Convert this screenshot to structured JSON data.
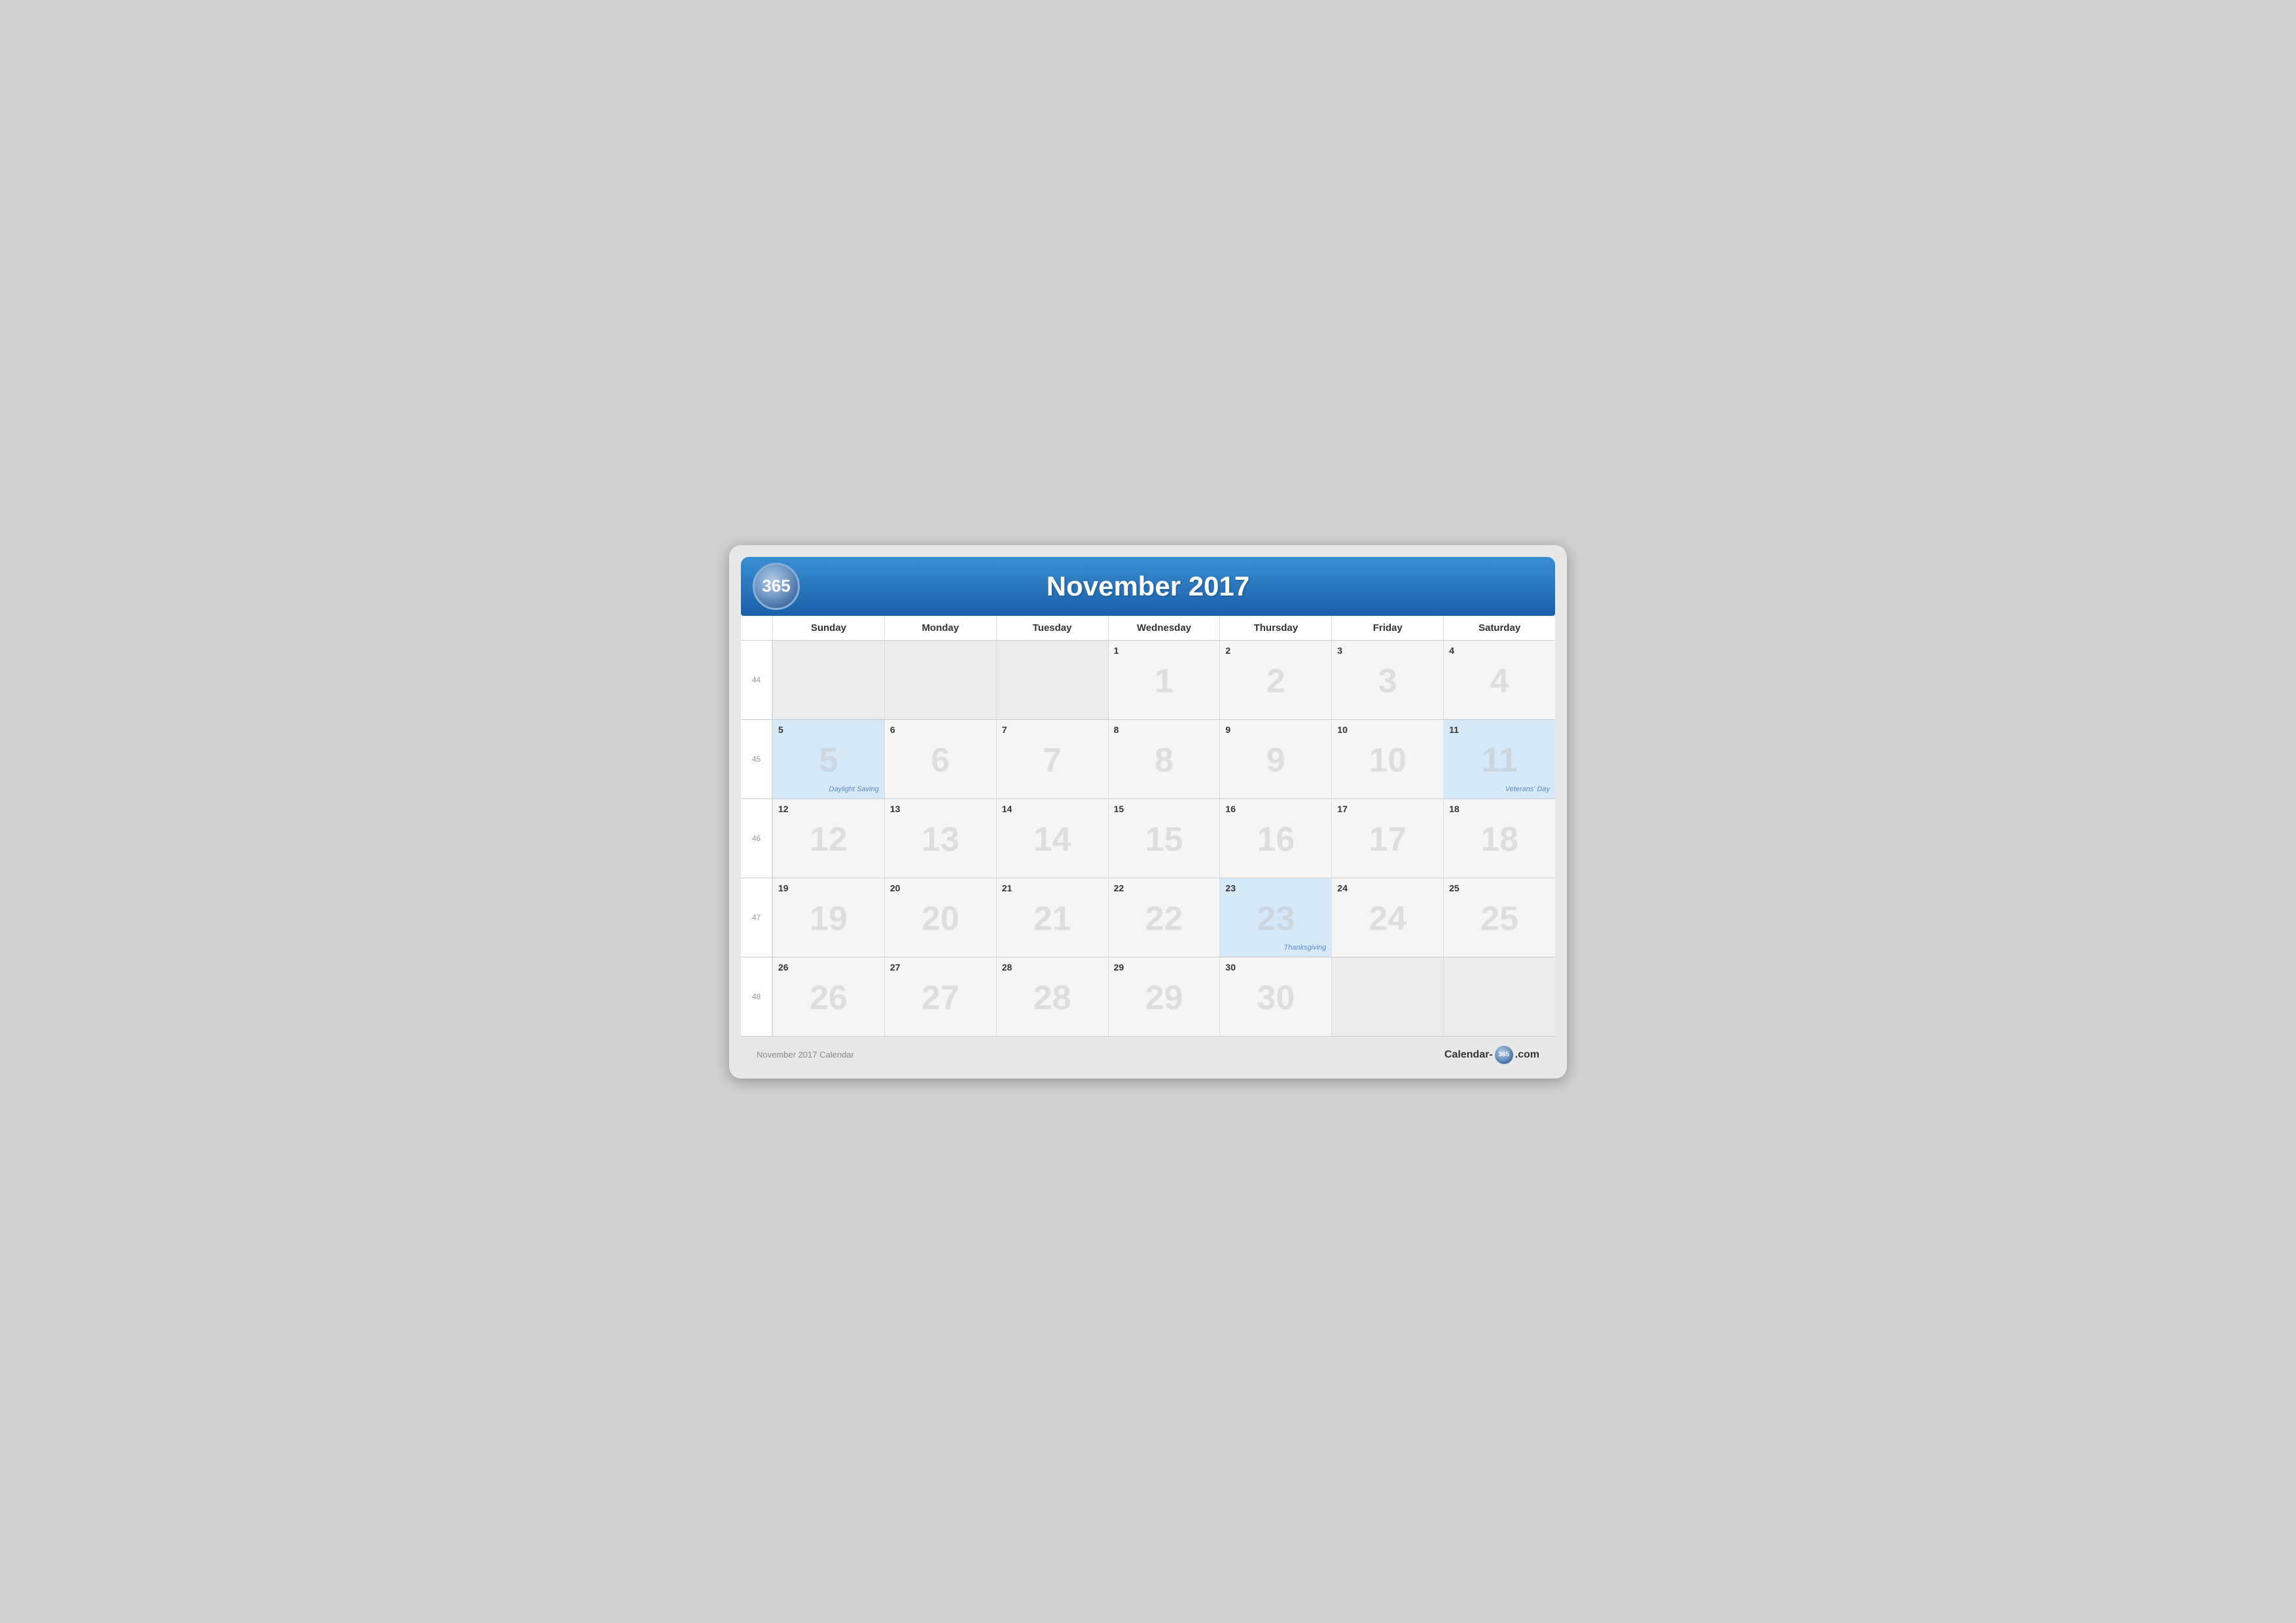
{
  "header": {
    "logo": "365",
    "title": "November 2017"
  },
  "dow_headers": [
    "Sunday",
    "Monday",
    "Tuesday",
    "Wednesday",
    "Thursday",
    "Friday",
    "Saturday"
  ],
  "weeks": [
    {
      "week_number": "44",
      "days": [
        {
          "date": "",
          "empty": true,
          "highlighted": false,
          "watermark": ""
        },
        {
          "date": "",
          "empty": true,
          "highlighted": false,
          "watermark": ""
        },
        {
          "date": "",
          "empty": true,
          "highlighted": false,
          "watermark": ""
        },
        {
          "date": "1",
          "empty": false,
          "highlighted": false,
          "watermark": "1"
        },
        {
          "date": "2",
          "empty": false,
          "highlighted": false,
          "watermark": "2"
        },
        {
          "date": "3",
          "empty": false,
          "highlighted": false,
          "watermark": "3"
        },
        {
          "date": "4",
          "empty": false,
          "highlighted": false,
          "watermark": "4"
        }
      ]
    },
    {
      "week_number": "45",
      "days": [
        {
          "date": "5",
          "empty": false,
          "highlighted": true,
          "watermark": "5",
          "event": "Daylight Saving"
        },
        {
          "date": "6",
          "empty": false,
          "highlighted": false,
          "watermark": "6"
        },
        {
          "date": "7",
          "empty": false,
          "highlighted": false,
          "watermark": "7"
        },
        {
          "date": "8",
          "empty": false,
          "highlighted": false,
          "watermark": "8"
        },
        {
          "date": "9",
          "empty": false,
          "highlighted": false,
          "watermark": "9"
        },
        {
          "date": "10",
          "empty": false,
          "highlighted": false,
          "watermark": "10"
        },
        {
          "date": "11",
          "empty": false,
          "highlighted": true,
          "watermark": "11",
          "event": "Veterans' Day"
        }
      ]
    },
    {
      "week_number": "46",
      "days": [
        {
          "date": "12",
          "empty": false,
          "highlighted": false,
          "watermark": "12"
        },
        {
          "date": "13",
          "empty": false,
          "highlighted": false,
          "watermark": "13"
        },
        {
          "date": "14",
          "empty": false,
          "highlighted": false,
          "watermark": "14"
        },
        {
          "date": "15",
          "empty": false,
          "highlighted": false,
          "watermark": "15"
        },
        {
          "date": "16",
          "empty": false,
          "highlighted": false,
          "watermark": "16"
        },
        {
          "date": "17",
          "empty": false,
          "highlighted": false,
          "watermark": "17"
        },
        {
          "date": "18",
          "empty": false,
          "highlighted": false,
          "watermark": "18"
        }
      ]
    },
    {
      "week_number": "47",
      "days": [
        {
          "date": "19",
          "empty": false,
          "highlighted": false,
          "watermark": "19"
        },
        {
          "date": "20",
          "empty": false,
          "highlighted": false,
          "watermark": "20"
        },
        {
          "date": "21",
          "empty": false,
          "highlighted": false,
          "watermark": "21"
        },
        {
          "date": "22",
          "empty": false,
          "highlighted": false,
          "watermark": "22"
        },
        {
          "date": "23",
          "empty": false,
          "highlighted": true,
          "watermark": "23",
          "event": "Thanksgiving"
        },
        {
          "date": "24",
          "empty": false,
          "highlighted": false,
          "watermark": "24"
        },
        {
          "date": "25",
          "empty": false,
          "highlighted": false,
          "watermark": "25"
        }
      ]
    },
    {
      "week_number": "48",
      "days": [
        {
          "date": "26",
          "empty": false,
          "highlighted": false,
          "watermark": "26"
        },
        {
          "date": "27",
          "empty": false,
          "highlighted": false,
          "watermark": "27"
        },
        {
          "date": "28",
          "empty": false,
          "highlighted": false,
          "watermark": "28"
        },
        {
          "date": "29",
          "empty": false,
          "highlighted": false,
          "watermark": "29"
        },
        {
          "date": "30",
          "empty": false,
          "highlighted": false,
          "watermark": "30"
        },
        {
          "date": "",
          "empty": true,
          "highlighted": false,
          "watermark": ""
        },
        {
          "date": "",
          "empty": true,
          "highlighted": false,
          "watermark": ""
        }
      ]
    }
  ],
  "footer": {
    "left_text": "November 2017 Calendar",
    "brand_text_left": "Calendar-",
    "brand_badge": "365",
    "brand_text_right": ".com"
  }
}
